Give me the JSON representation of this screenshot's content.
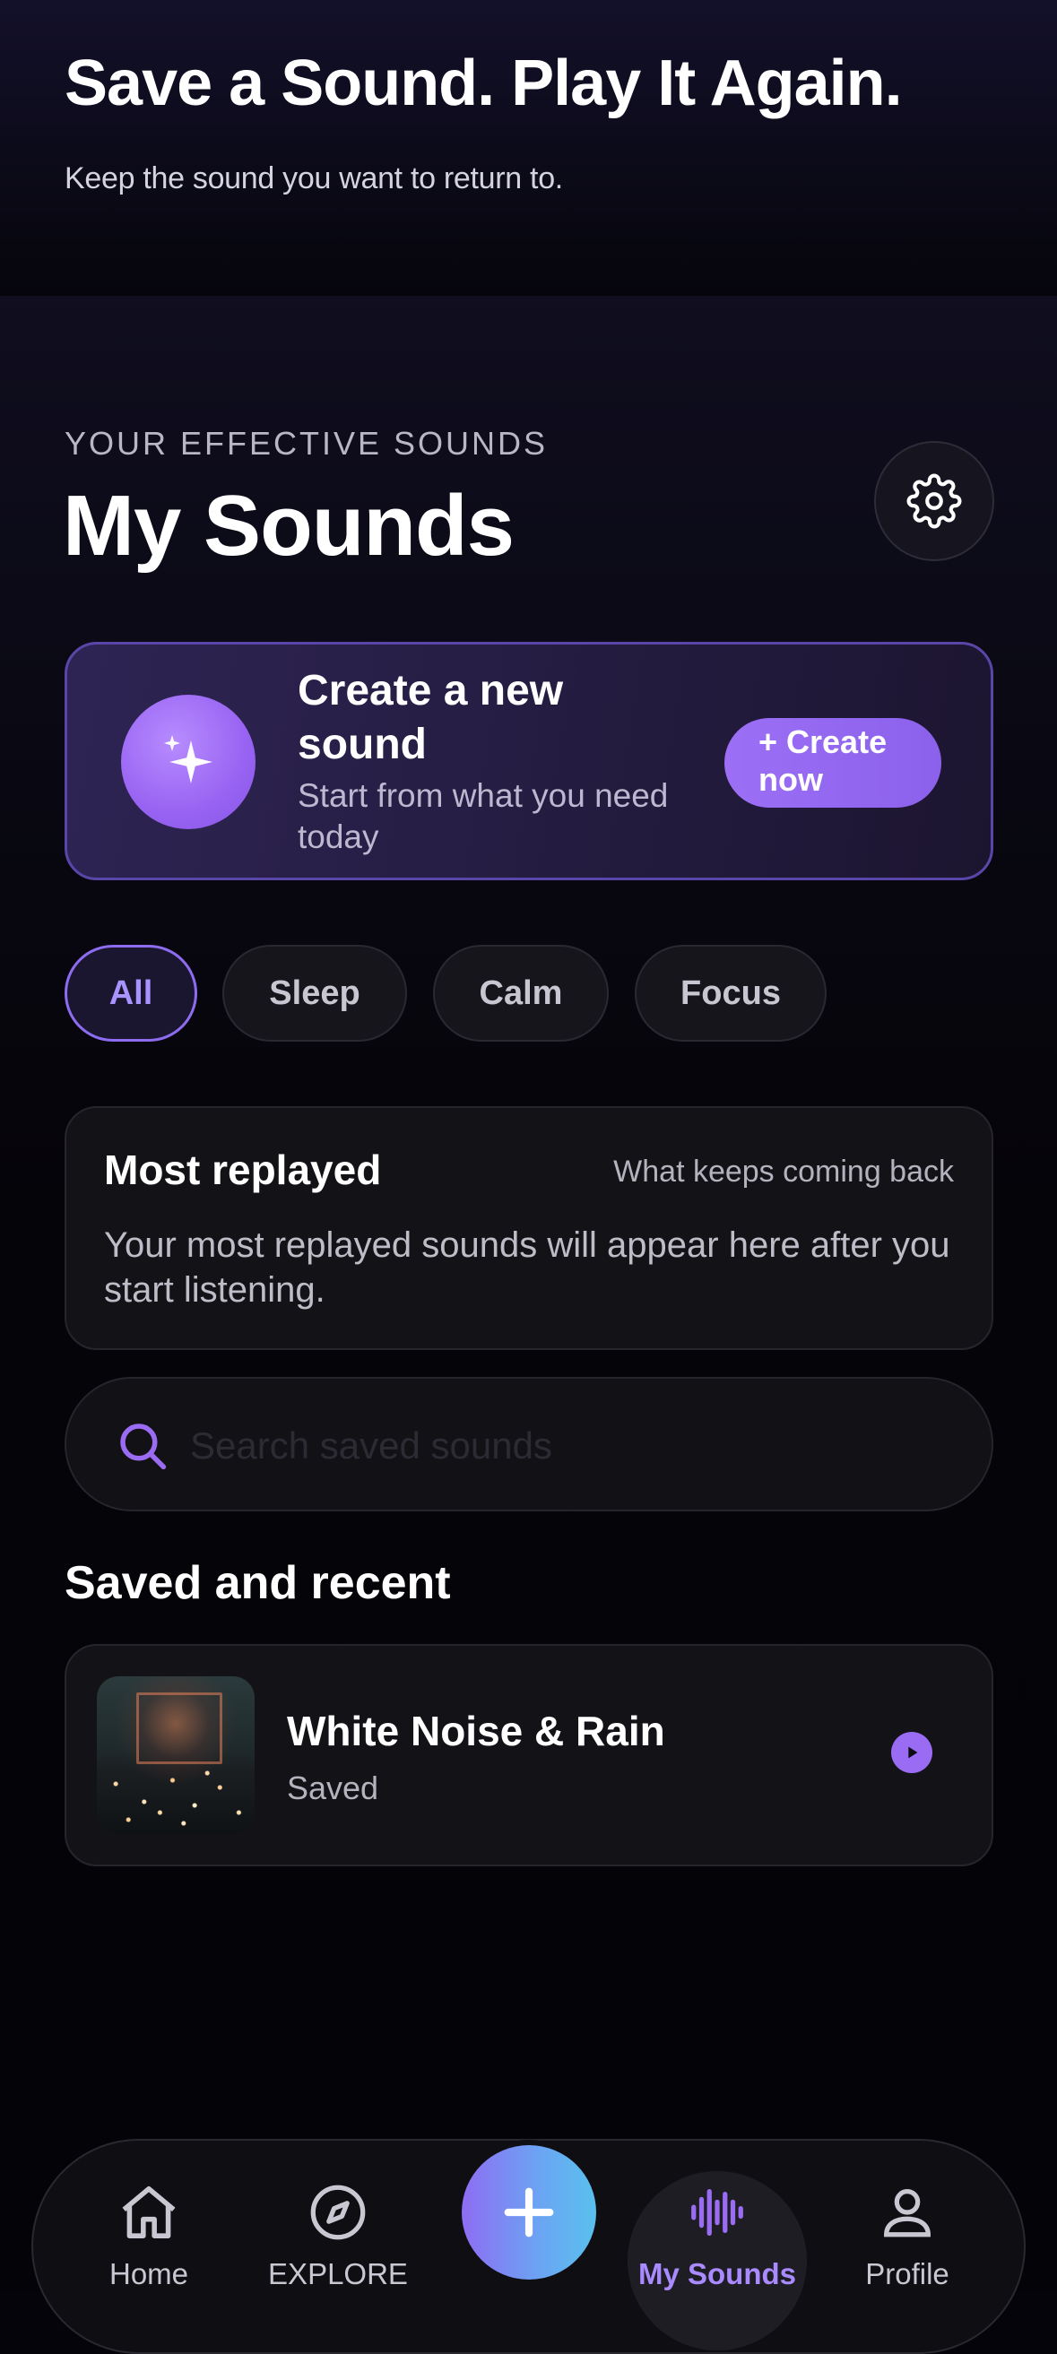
{
  "hero": {
    "title": "Save a Sound. Play It Again.",
    "subtitle": "Keep the sound you want to return to."
  },
  "header": {
    "eyebrow": "YOUR EFFECTIVE SOUNDS",
    "title": "My Sounds",
    "settings_icon": "gear-icon"
  },
  "create_card": {
    "icon": "sparkles-icon",
    "title": "Create a new sound",
    "subtitle": "Start from what you need today",
    "button_label": "+ Create now"
  },
  "filters": {
    "selected": "All",
    "items": [
      "All",
      "Sleep",
      "Calm",
      "Focus"
    ]
  },
  "most_replayed": {
    "title": "Most replayed",
    "tagline": "What keeps coming back",
    "body": "Your most replayed sounds will appear here after you start listening."
  },
  "search": {
    "placeholder": "Search saved sounds",
    "value": ""
  },
  "saved_section": {
    "title": "Saved and recent",
    "items": [
      {
        "name": "White Noise & Rain",
        "status": "Saved",
        "action_icon": "play-icon"
      }
    ]
  },
  "tabbar": {
    "active": "My Sounds",
    "items": [
      {
        "label": "Home",
        "icon": "home-icon"
      },
      {
        "label": "EXPLORE",
        "icon": "compass-icon"
      },
      {
        "label": "My Sounds",
        "icon": "waveform-icon"
      },
      {
        "label": "Profile",
        "icon": "person-icon"
      }
    ],
    "fab_icon": "plus-icon"
  },
  "colors": {
    "accent": "#9a6cf4",
    "accent_text": "#a98bff",
    "background": "#05040a",
    "card": "#131217"
  }
}
